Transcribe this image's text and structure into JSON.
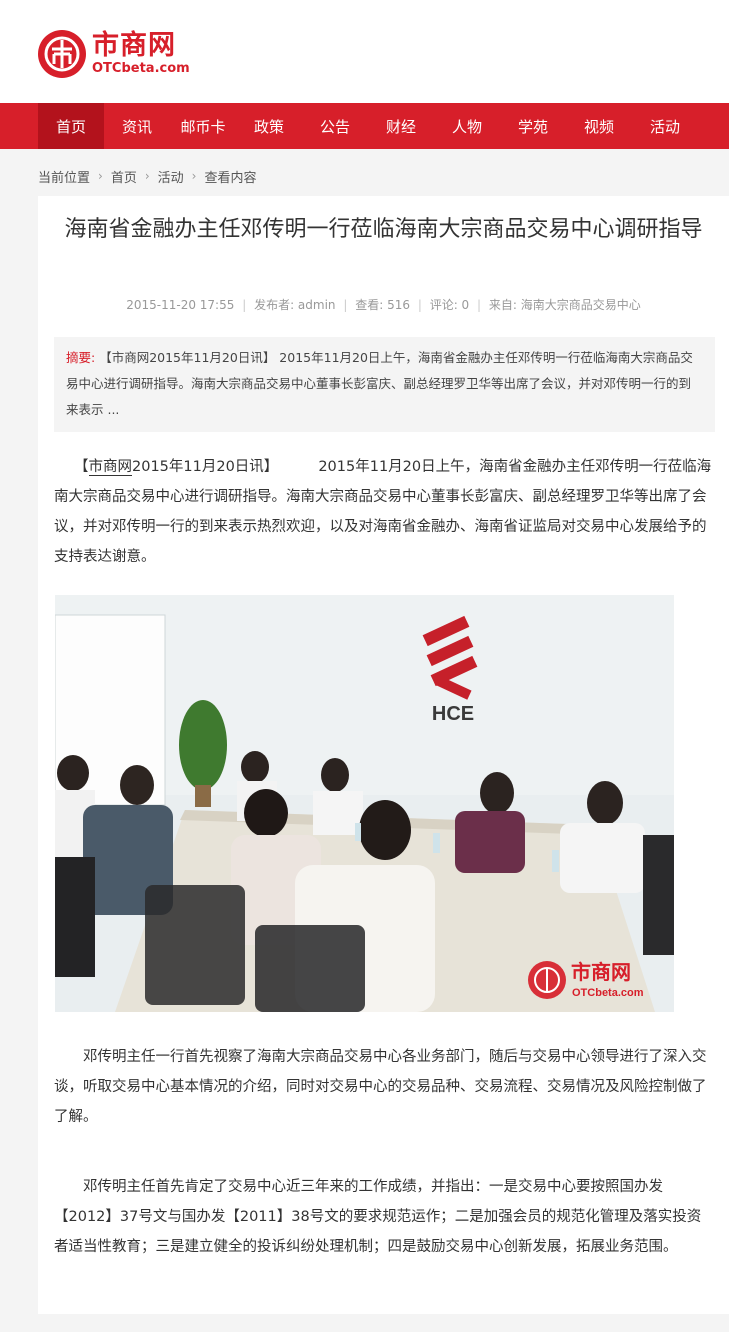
{
  "header": {
    "logo_title": "市商网",
    "logo_sub": "OTCbeta.com"
  },
  "nav": {
    "items": [
      {
        "label": "首页",
        "active": true
      },
      {
        "label": "资讯"
      },
      {
        "label": "邮币卡"
      },
      {
        "label": "政策"
      },
      {
        "label": "公告"
      },
      {
        "label": "财经"
      },
      {
        "label": "人物"
      },
      {
        "label": "学苑"
      },
      {
        "label": "视频"
      },
      {
        "label": "活动"
      }
    ]
  },
  "breadcrumb": {
    "prefix": "当前位置",
    "items": [
      "首页",
      "活动",
      "查看内容"
    ]
  },
  "article": {
    "title": "海南省金融办主任邓传明一行莅临海南大宗商品交易中心调研指导",
    "meta": {
      "date": "2015-11-20 17:55",
      "author": "发布者: admin",
      "views": "查看: 516",
      "comments": "评论: 0",
      "source": "来自: 海南大宗商品交易中心"
    },
    "summary_label": "摘要:",
    "summary_text": "【市商网2015年11月20日讯】 2015年11月20日上午，海南省金融办主任邓传明一行莅临海南大宗商品交易中心进行调研指导。海南大宗商品交易中心董事长彭富庆、副总经理罗卫华等出席了会议，并对邓传明一行的到来表示 ...",
    "p1_open": "【",
    "p1_brand": "市商网",
    "p1_date": "2015年11月20日讯】",
    "p1_body": "2015年11月20日上午，海南省金融办主任邓传明一行莅临海南大宗商品交易中心进行调研指导。海南大宗商品交易中心董事长彭富庆、副总经理罗卫华等出席了会议，并对邓传明一行的到来表示热烈欢迎，以及对海南省金融办、海南省证监局对交易中心发展给予的支持表达谢意。",
    "photo": {
      "wall_logo_text": "HCE",
      "watermark_title": "市商网",
      "watermark_sub": "OTCbeta.com"
    },
    "p2": "邓传明主任一行首先视察了海南大宗商品交易中心各业务部门，随后与交易中心领导进行了深入交谈，听取交易中心基本情况的介绍，同时对交易中心的交易品种、交易流程、交易情况及风险控制做了了解。",
    "p3": "邓传明主任首先肯定了交易中心近三年来的工作成绩，并指出：一是交易中心要按照国办发【2012】37号文与国办发【2011】38号文的要求规范运作；二是加强会员的规范化管理及落实投资者适当性教育；三是建立健全的投诉纠纷处理机制；四是鼓励交易中心创新发展，拓展业务范围。"
  },
  "colors": {
    "brand_red": "#d71f2a",
    "nav_active": "#b3121c",
    "page_bg": "#f4f4f4"
  }
}
